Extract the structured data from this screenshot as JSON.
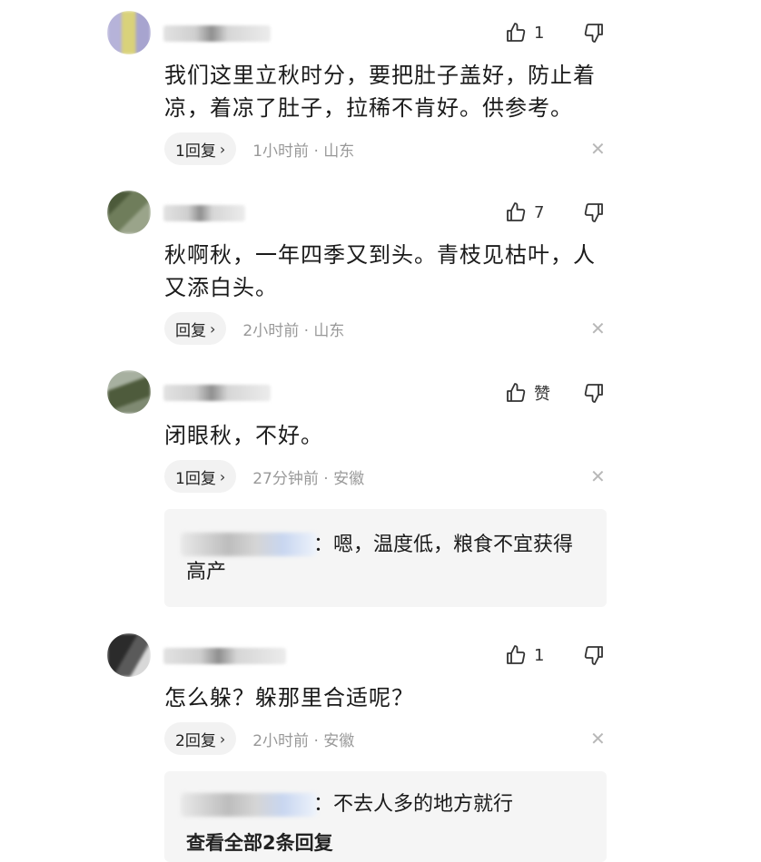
{
  "comments": [
    {
      "text": "我们这里立秋时分，要把肚子盖好，防止着凉，着凉了肚子，拉稀不肯好。供参考。",
      "likes": "1",
      "reply_label": "1回复",
      "meta": "1小时前 · 山东"
    },
    {
      "text": "秋啊秋，一年四季又到头。青枝见枯叶，人又添白头。",
      "likes": "7",
      "reply_label": "回复",
      "meta": "2小时前 · 山东"
    },
    {
      "text": "闭眼秋，不好。",
      "likes": "赞",
      "reply_label": "1回复",
      "meta": "27分钟前 · 安徽",
      "subreply": {
        "text": "：嗯，温度低，粮食不宜获得高产"
      }
    },
    {
      "text": "怎么躲？躲那里合适呢？",
      "likes": "1",
      "reply_label": "2回复",
      "meta": "2小时前 · 安徽",
      "subreply": {
        "text": "：不去人多的地方就行"
      },
      "see_all": "查看全部2条回复"
    }
  ],
  "icons": {
    "like": "thumbs-up-icon",
    "dislike": "thumbs-down-icon",
    "close": "close-icon",
    "chevron": "chevron-right-icon"
  },
  "glyphs": {
    "close": "✕",
    "chevron": "›"
  }
}
